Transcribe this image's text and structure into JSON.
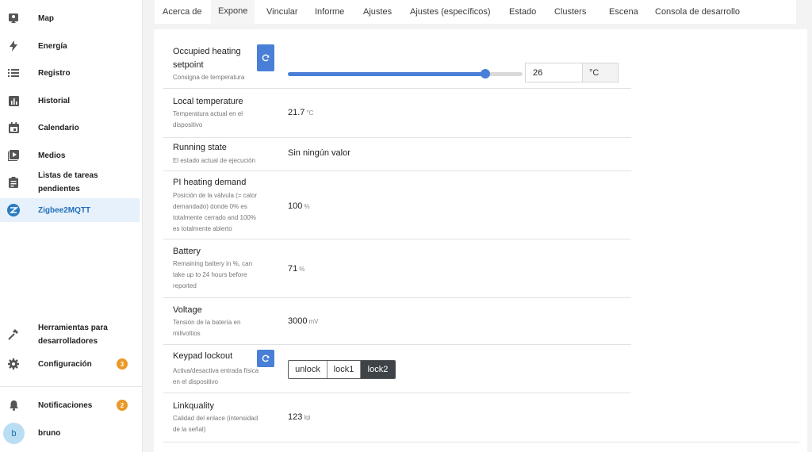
{
  "sidebar": {
    "items": [
      {
        "label": "Map",
        "icon": "map-icon"
      },
      {
        "label": "Energía",
        "icon": "lightning-icon"
      },
      {
        "label": "Registro",
        "icon": "list-icon"
      },
      {
        "label": "Historial",
        "icon": "chart-icon"
      },
      {
        "label": "Calendario",
        "icon": "calendar-icon"
      },
      {
        "label": "Medios",
        "icon": "play-icon"
      },
      {
        "label": "Listas de tareas pendientes",
        "icon": "clipboard-icon"
      },
      {
        "label": "Zigbee2MQTT",
        "icon": "zigbee-icon"
      }
    ],
    "dev_tools": {
      "line1": "Herramientas para",
      "line2": "desarrolladores"
    },
    "config": {
      "label": "Configuración",
      "badge": "3"
    },
    "notifications": {
      "label": "Notificaciones",
      "badge": "2"
    },
    "user": {
      "initial": "b",
      "name": "bruno"
    }
  },
  "tabs": [
    "Acerca de",
    "Expone",
    "Vincular",
    "Informe",
    "Ajustes",
    "Ajustes (específicos)",
    "Estado",
    "Clusters",
    "Escena",
    "Consola de desarrollo"
  ],
  "active_tab": "Expone",
  "rows": {
    "setpoint": {
      "title1": "Occupied heating",
      "title2": "setpoint",
      "desc": "Consigna de temperatura",
      "value": "26",
      "unit": "°C",
      "slider_fraction": 0.84
    },
    "local_temp": {
      "title": "Local temperature",
      "desc1": "Temperatura actual en el",
      "desc2": "dispositivo",
      "value": "21.7",
      "unit": "°C"
    },
    "running_state": {
      "title": "Running state",
      "desc": "El estado actual de ejecución",
      "value": "Sin ningún valor"
    },
    "pi_demand": {
      "title": "PI heating demand",
      "desc1": "Posición de la válvula (= calor",
      "desc2": "demandado) donde 0% es",
      "desc3": "totalmente cerrado and 100%",
      "desc4": "es totalmente abierto",
      "value": "100",
      "unit": "%"
    },
    "battery": {
      "title": "Battery",
      "desc1": "Remaining battery in %, can",
      "desc2": "take up to 24 hours before",
      "desc3": "reported",
      "value": "71",
      "unit": "%"
    },
    "voltage": {
      "title": "Voltage",
      "desc1": "Tensión de la batería en",
      "desc2": "milivoltios",
      "value": "3000",
      "unit": "mV"
    },
    "keypad": {
      "title": "Keypad lockout",
      "desc1": "Activa/desactiva entrada física",
      "desc2": "en el dispositivo",
      "options": [
        "unlock",
        "lock1",
        "lock2"
      ],
      "selected": "lock2"
    },
    "linkquality": {
      "title": "Linkquality",
      "desc1": "Calidad del enlace (intensidad",
      "desc2": "de la señal)",
      "value": "123",
      "unit": "lqi"
    }
  },
  "colors": {
    "accent": "#4a7fd8",
    "active_nav_bg": "#e7f1fb",
    "badge": "#e99a26"
  }
}
